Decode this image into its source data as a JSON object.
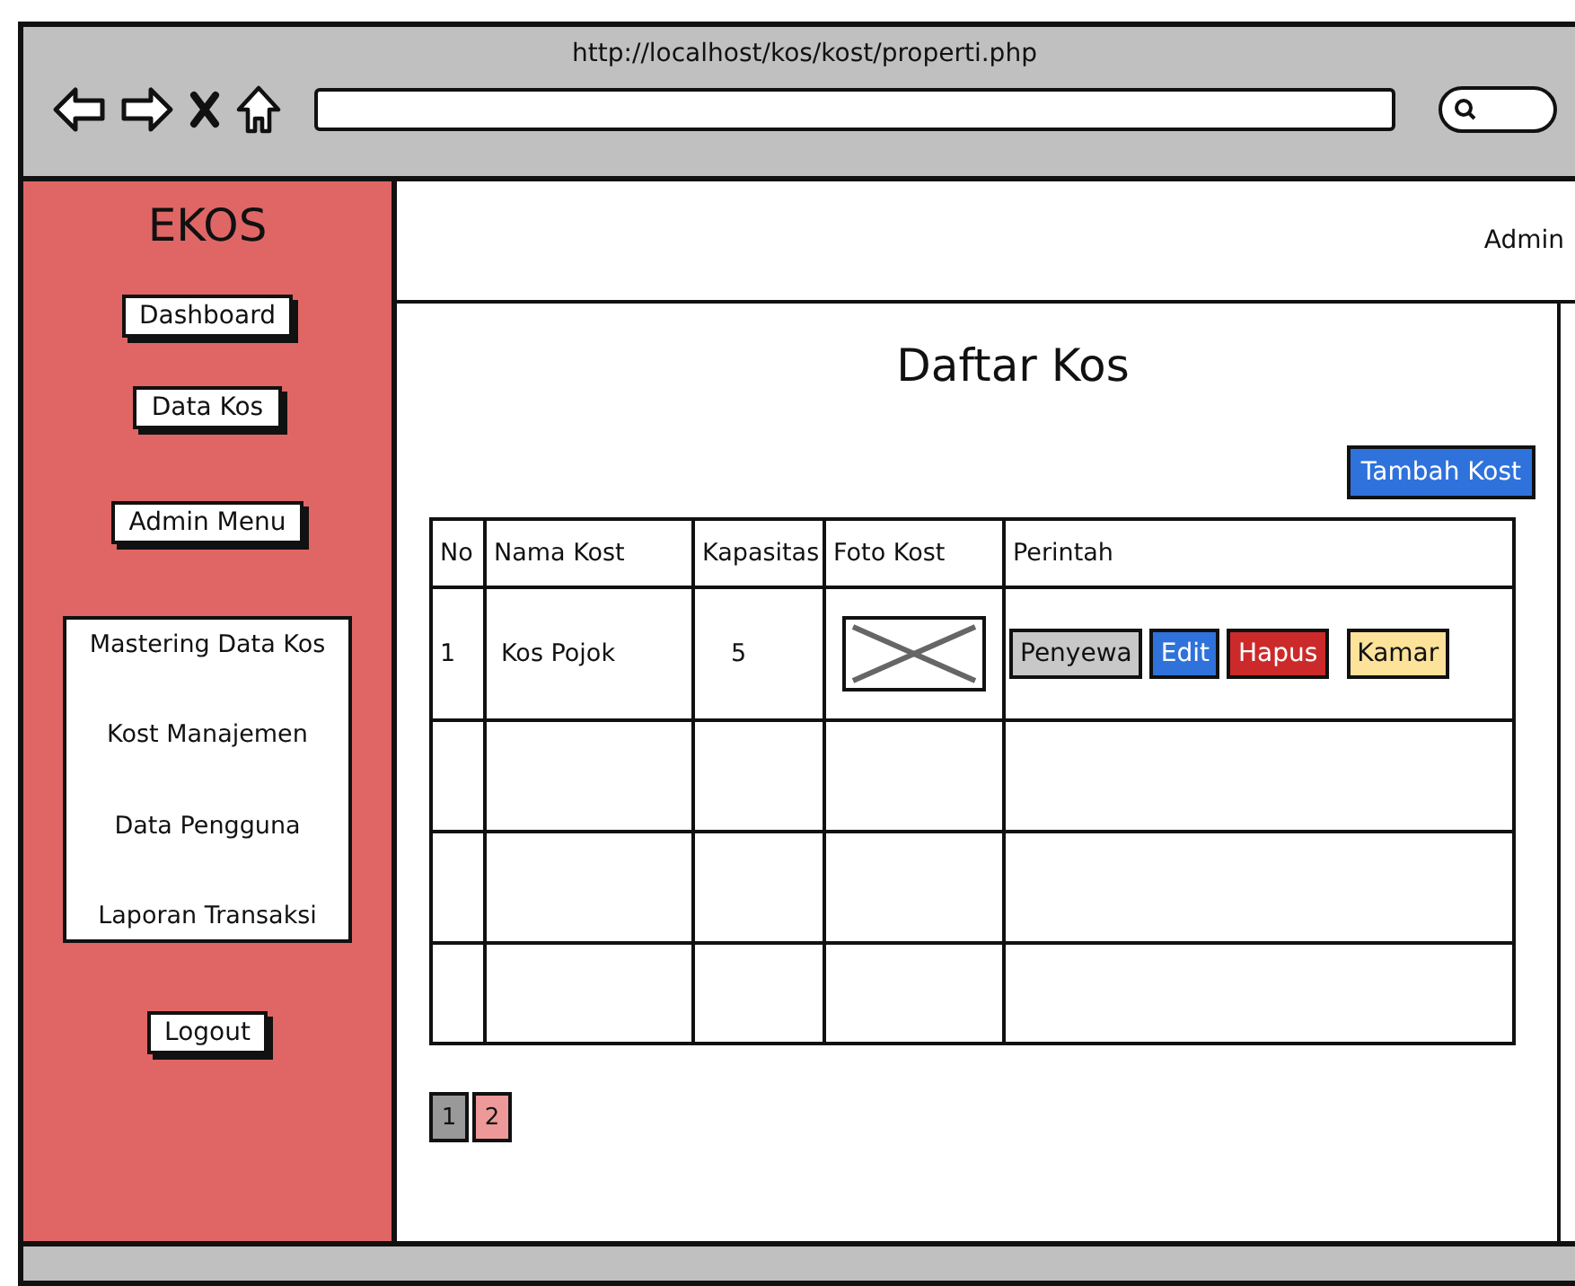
{
  "browser": {
    "url": "http://localhost/kos/kost/properti.php"
  },
  "sidebar": {
    "logo": "EKOS",
    "buttons": [
      {
        "label": "Dashboard"
      },
      {
        "label": "Data Kos"
      },
      {
        "label": "Admin Menu"
      }
    ],
    "submenu": [
      {
        "label": "Mastering Data Kos"
      },
      {
        "label": "Kost Manajemen"
      },
      {
        "label": "Data Pengguna"
      },
      {
        "label": "Laporan Transaksi"
      }
    ],
    "logout": "Logout"
  },
  "header": {
    "user": "Admin"
  },
  "page": {
    "title": "Daftar Kos",
    "add_button": "Tambah Kost"
  },
  "table": {
    "columns": [
      "No",
      "Nama Kost",
      "Kapasitas",
      "Foto Kost",
      "Perintah"
    ],
    "rows": [
      {
        "no": "1",
        "name": "Kos Pojok",
        "capacity": "5",
        "photo": {
          "kind": "picture"
        },
        "actions": [
          {
            "label": "Penyewa",
            "color": "#c8c8c8"
          },
          {
            "label": "Edit",
            "color": "#2f72dc"
          },
          {
            "label": "Hapus",
            "color": "#cc2a2a"
          },
          {
            "label": "Kamar",
            "color": "#fde29a"
          }
        ]
      }
    ]
  },
  "pagination": [
    {
      "label": "1",
      "selected": true
    },
    {
      "label": "2",
      "selected": false
    }
  ]
}
